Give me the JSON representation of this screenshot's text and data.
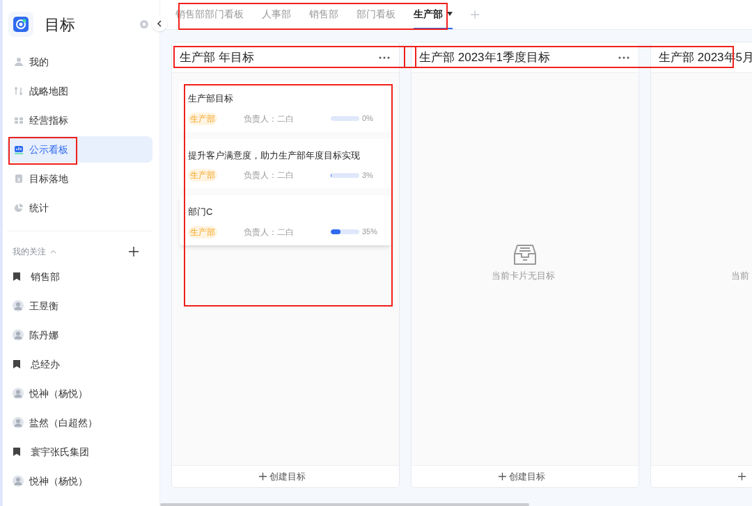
{
  "app": {
    "title": "目标"
  },
  "nav": [
    {
      "label": "我的",
      "selected": false
    },
    {
      "label": "战略地图",
      "selected": false
    },
    {
      "label": "经营指标",
      "selected": false
    },
    {
      "label": "公示看板",
      "selected": true
    },
    {
      "label": "目标落地",
      "selected": false
    },
    {
      "label": "统计",
      "selected": false
    }
  ],
  "follows": {
    "title": "我的关注",
    "expanded": true,
    "items": [
      {
        "label": "销售部",
        "kind": "group"
      },
      {
        "label": "王昱衡",
        "kind": "person"
      },
      {
        "label": "陈丹娜",
        "kind": "person"
      },
      {
        "label": "总经办",
        "kind": "group"
      },
      {
        "label": "悦神（杨悦）",
        "kind": "person"
      },
      {
        "label": "盐然（白超然）",
        "kind": "person"
      },
      {
        "label": "寰宇张氏集团",
        "kind": "group"
      },
      {
        "label": "悦神（杨悦）",
        "kind": "person"
      }
    ]
  },
  "tabs": [
    {
      "label": "销售部部门看板",
      "selected": false
    },
    {
      "label": "人事部",
      "selected": false
    },
    {
      "label": "销售部",
      "selected": false
    },
    {
      "label": "部门看板",
      "selected": false
    },
    {
      "label": "生产部",
      "selected": true
    }
  ],
  "columns": [
    {
      "title": "生产部 年目标",
      "menu": true,
      "create_label": "创建目标",
      "cards": [
        {
          "title": "生产部目标",
          "tag": "生产部",
          "owner": "负责人：二白",
          "level": 0,
          "percent": "0%"
        },
        {
          "title": "提升客户满意度，助力生产部年度目标实现",
          "tag": "生产部",
          "owner": "负责人：二白",
          "level": 0.03,
          "percent": "3%"
        },
        {
          "title": "部门C",
          "tag": "生产部",
          "owner": "负责人：二白",
          "level": 0.35,
          "percent": "35%"
        }
      ]
    },
    {
      "title": "生产部 2023年1季度目标",
      "menu": true,
      "empty_text": "当前卡片无目标",
      "create_label": "创建目标"
    },
    {
      "title": "生产部 2023年5月",
      "menu": false,
      "empty_text": "当前"
    }
  ]
}
